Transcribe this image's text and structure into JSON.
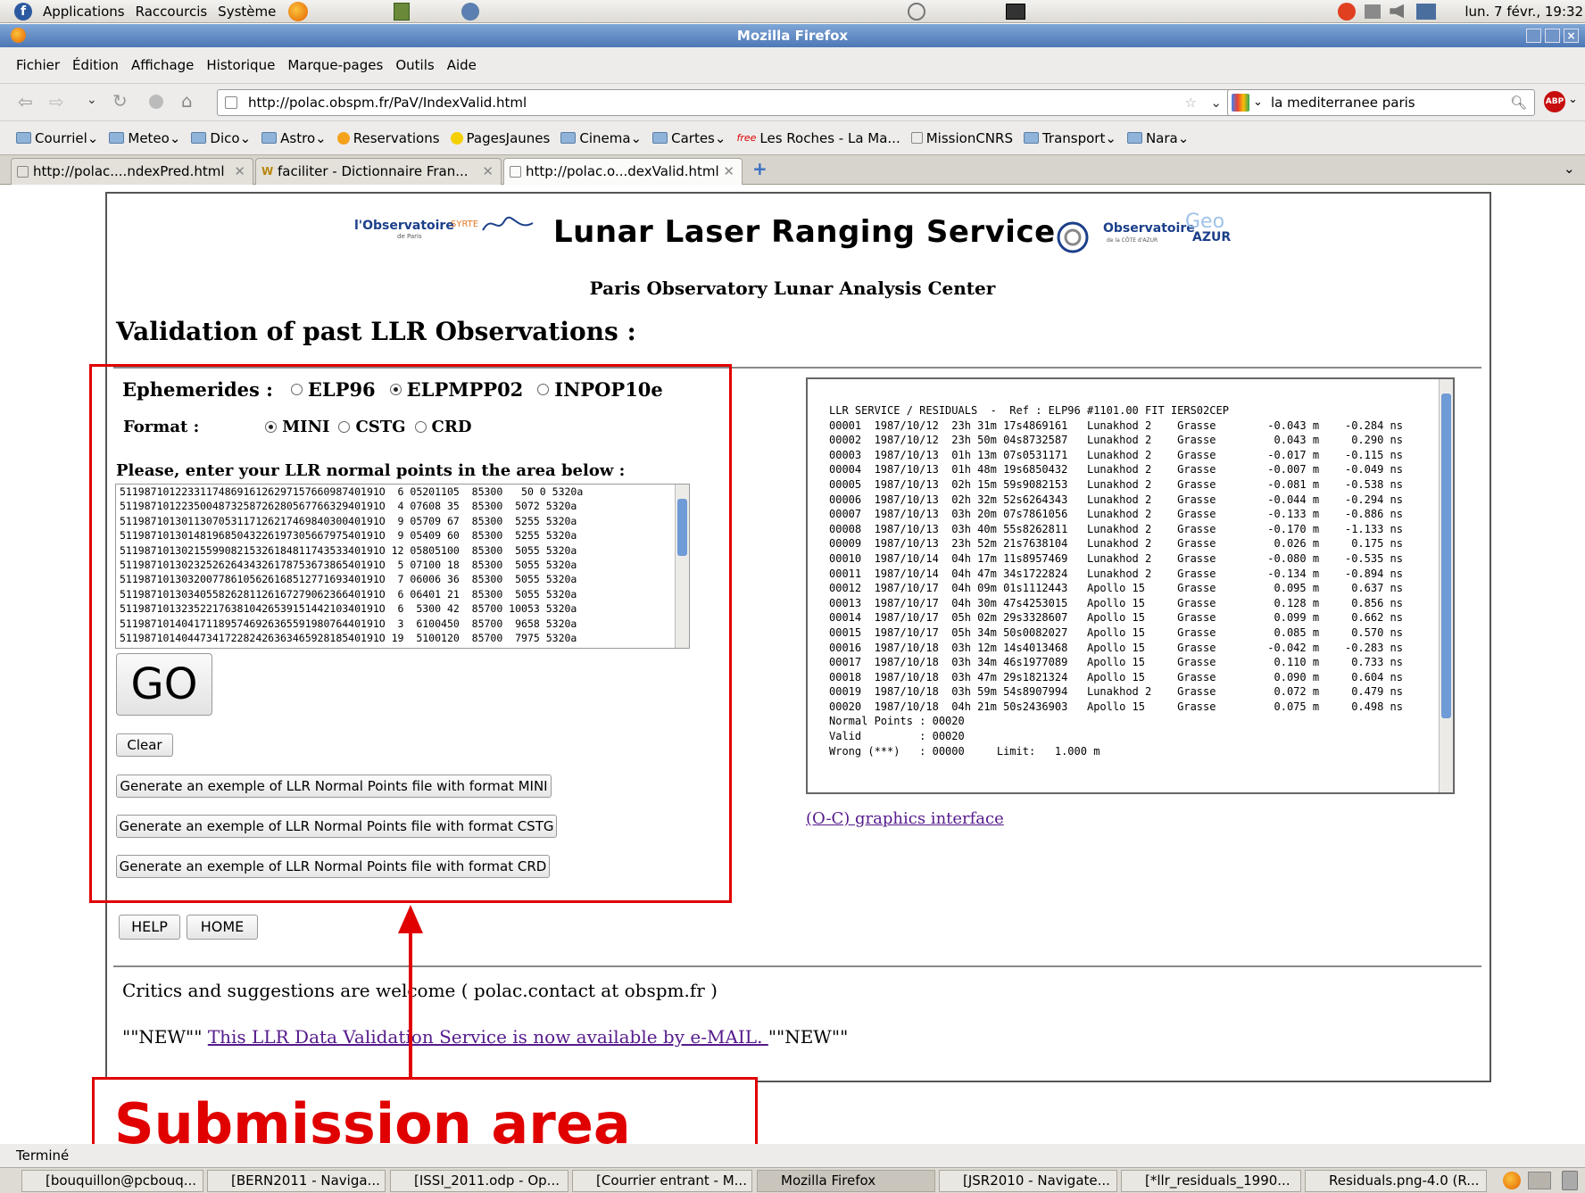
{
  "desktop": {
    "menus": [
      "Applications",
      "Raccourcis",
      "Système"
    ],
    "clock": "lun. 7 févr., 19:32"
  },
  "window": {
    "title": "Mozilla Firefox"
  },
  "menubar": [
    "Fichier",
    "Édition",
    "Affichage",
    "Historique",
    "Marque-pages",
    "Outils",
    "Aide"
  ],
  "navigation": {
    "url": "http://polac.obspm.fr/PaV/IndexValid.html",
    "search_value": "la mediterranee paris",
    "abp_label": "ABP"
  },
  "bookmarks": [
    "Courriel",
    "Meteo",
    "Dico",
    "Astro",
    "Reservations",
    "PagesJaunes",
    "Cinema",
    "Cartes",
    "Les Roches - La Ma...",
    "MissionCNRS",
    "Transport",
    "Nara"
  ],
  "tabs": [
    "http://polac....ndexPred.html",
    "faciliter - Dictionnaire Fran...",
    "http://polac.o...dexValid.html"
  ],
  "page": {
    "logo_left": "l'Observatoire",
    "logo_left_sub": "de Paris",
    "logo_syrte": "SYRTE",
    "title": "Lunar Laser Ranging Service",
    "logo_right": "Observatoire",
    "logo_right_sub": "de la CÔTE d'AZUR",
    "logo_geo": "Geo",
    "logo_azur": "AZUR",
    "subtitle": "Paris Observatory Lunar Analysis Center",
    "heading": "Validation of past LLR Observations :",
    "ephemerides_label": "Ephemerides :",
    "ephemerides_options": [
      "ELP96",
      "ELPMPP02",
      "INPOP10e"
    ],
    "ephemerides_selected": "ELPMPP02",
    "format_label": "Format :",
    "format_options": [
      "MINI",
      "CSTG",
      "CRD"
    ],
    "format_selected": "MINI",
    "input_label": "Please, enter your LLR normal points in the area below :",
    "input_lines": [
      "511987101223311748691612629715766098740191O  6 05201105  85300   50 0 5320a",
      "511987101223500487325872628056776632940191O  4 07608 35  85300  5072 5320a",
      "511987101301130705311712621746984030040191O  9 05709 67  85300  5255 5320a",
      "511987101301481968504322619730566797540191O  9 05409 60  85300  5255 5320a",
      "511987101302155990821532618481174353340191O 12 05805100  85300  5055 5320a",
      "511987101302325262643432617875367386540191O  5 07100 18  85300  5055 5320a",
      "511987101303200778610562616851277169340191O  7 06006 36  85300  5055 5320a",
      "511987101303405582628112616727906236640191O  6 06401 21  85300  5055 5320a",
      "511987101323522176381042653915144210340191O  6  5300 42  85700 10053 5320a",
      "511987101404171189574692636559198076440191O  3  6100450  85700  9658 5320a",
      "511987101404473417228242636346592818540191O 19  5100120  85700  7975 5320a"
    ],
    "go_label": "GO",
    "clear_label": "Clear",
    "gen_mini_label": "Generate an exemple of LLR Normal Points file with format MINI",
    "gen_cstg_label": "Generate an exemple of LLR Normal Points file with format CSTG",
    "gen_crd_label": "Generate an exemple of LLR Normal Points file with format CRD",
    "help_label": "HELP",
    "home_label": "HOME",
    "results_lines": [
      "LLR SERVICE / RESIDUALS  -  Ref : ELP96 #1101.00 FIT IERS02CEP",
      "",
      "00001  1987/10/12  23h 31m 17s4869161   Lunakhod 2    Grasse        -0.043 m    -0.284 ns",
      "00002  1987/10/12  23h 50m 04s8732587   Lunakhod 2    Grasse         0.043 m     0.290 ns",
      "00003  1987/10/13  01h 13m 07s0531171   Lunakhod 2    Grasse        -0.017 m    -0.115 ns",
      "00004  1987/10/13  01h 48m 19s6850432   Lunakhod 2    Grasse        -0.007 m    -0.049 ns",
      "00005  1987/10/13  02h 15m 59s9082153   Lunakhod 2    Grasse        -0.081 m    -0.538 ns",
      "00006  1987/10/13  02h 32m 52s6264343   Lunakhod 2    Grasse        -0.044 m    -0.294 ns",
      "00007  1987/10/13  03h 20m 07s7861056   Lunakhod 2    Grasse        -0.133 m    -0.886 ns",
      "00008  1987/10/13  03h 40m 55s8262811   Lunakhod 2    Grasse        -0.170 m    -1.133 ns",
      "00009  1987/10/13  23h 52m 21s7638104   Lunakhod 2    Grasse         0.026 m     0.175 ns",
      "00010  1987/10/14  04h 17m 11s8957469   Lunakhod 2    Grasse        -0.080 m    -0.535 ns",
      "00011  1987/10/14  04h 47m 34s1722824   Lunakhod 2    Grasse        -0.134 m    -0.894 ns",
      "00012  1987/10/17  04h 09m 01s1112443   Apollo 15     Grasse         0.095 m     0.637 ns",
      "00013  1987/10/17  04h 30m 47s4253015   Apollo 15     Grasse         0.128 m     0.856 ns",
      "00014  1987/10/17  05h 02m 29s3328607   Apollo 15     Grasse         0.099 m     0.662 ns",
      "00015  1987/10/17  05h 34m 50s0082027   Apollo 15     Grasse         0.085 m     0.570 ns",
      "00016  1987/10/18  03h 12m 14s4013468   Apollo 15     Grasse        -0.042 m    -0.283 ns",
      "00017  1987/10/18  03h 34m 46s1977089   Apollo 15     Grasse         0.110 m     0.733 ns",
      "00018  1987/10/18  03h 47m 29s1821324   Apollo 15     Grasse         0.090 m     0.604 ns",
      "00019  1987/10/18  03h 59m 54s8907994   Lunakhod 2    Grasse         0.072 m     0.479 ns",
      "00020  1987/10/18  04h 21m 50s2436903   Apollo 15     Grasse         0.075 m     0.498 ns",
      "",
      "Normal Points : 00020",
      "Valid         : 00020",
      "Wrong (***)   : 00000     Limit:   1.000 m"
    ],
    "oc_link": "(O-C) graphics interface",
    "critics": "Critics and suggestions are welcome ( polac.contact at obspm.fr )",
    "new_prefix": "\"\"NEW\"\"",
    "new_link": "This LLR Data Validation Service is now available by e-MAIL. ",
    "new_suffix": "\"\"NEW\"\""
  },
  "annotation": {
    "label": "Submission area",
    "color": "#e00000"
  },
  "status": "Terminé",
  "taskbar": [
    "[bouquillon@pcbouq...",
    "[BERN2011 - Naviga...",
    "[ISSI_2011.odp - Op...",
    "[Courrier entrant - M...",
    "Mozilla Firefox",
    "[JSR2010 - Navigate...",
    "[*llr_residuals_1990...",
    "Residuals.png-4.0 (R..."
  ]
}
